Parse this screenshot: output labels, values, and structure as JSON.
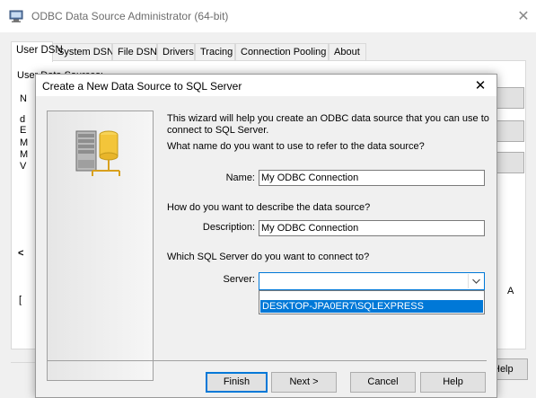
{
  "outer_window": {
    "title": "ODBC Data Source Administrator (64-bit)",
    "close_glyph": "✕",
    "tabs": [
      {
        "label": "User DSN",
        "active": true
      },
      {
        "label": "System DSN",
        "active": false
      },
      {
        "label": "File DSN",
        "active": false
      },
      {
        "label": "Drivers",
        "active": false
      },
      {
        "label": "Tracing",
        "active": false
      },
      {
        "label": "Connection Pooling",
        "active": false
      },
      {
        "label": "About",
        "active": false
      }
    ],
    "panel_fragments": {
      "user_data_sources": "User Data Sources:",
      "letters": [
        "N",
        "d",
        "E",
        "M",
        "M",
        "V"
      ],
      "scroll_left": "<",
      "right_letter": "A",
      "left_bracket": "["
    },
    "help_button": "Help"
  },
  "dialog": {
    "title": "Create a New Data Source to SQL Server",
    "close_glyph": "✕",
    "intro_line1": "This wizard will help you create an ODBC data source that you can use to",
    "intro_line2": "connect to SQL Server.",
    "q_name": "What name do you want to use to refer to the data source?",
    "name_label": "Name:",
    "name_value": "My ODBC Connection",
    "q_describe": "How do you want to describe the data source?",
    "description_label": "Description:",
    "description_value": "My ODBC Connection",
    "q_server": "Which SQL Server do you want to connect to?",
    "server_label": "Server:",
    "server_value": "",
    "server_options": [
      "DESKTOP-JPA0ER7\\SQLEXPRESS"
    ],
    "buttons": {
      "finish": "Finish",
      "next": "Next >",
      "cancel": "Cancel",
      "help": "Help"
    }
  },
  "colors": {
    "accent": "#0078d7",
    "window_bg": "#f0f0f0",
    "border": "#adadad"
  }
}
